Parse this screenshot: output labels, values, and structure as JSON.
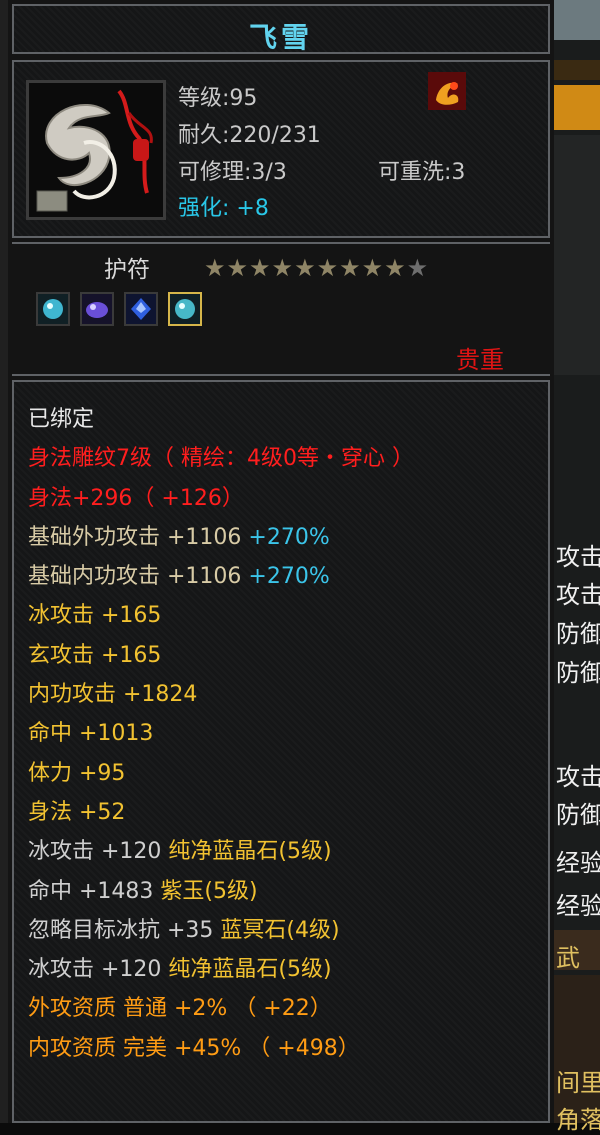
{
  "item": {
    "name": "飞雪",
    "level_text": "等级:95",
    "durability_text": "耐久:220/231",
    "repairable_text": "可修理:3/3",
    "rewash_text": "可重洗:3",
    "enhance_text": "强化: +8",
    "type": "护符",
    "stars_filled": 9,
    "stars_total": 10,
    "stars_text": "★★★★★★★★★",
    "stars_off_text": "★",
    "precious_text": "贵重",
    "gems": [
      {
        "icon": "teal-gem-icon",
        "color": "#3fb6d0"
      },
      {
        "icon": "purple-gem-icon",
        "color": "#6a4fd8"
      },
      {
        "icon": "blue-gem-icon",
        "color": "#2f5fe0"
      },
      {
        "icon": "teal-gem-icon",
        "color": "#47b8c8",
        "selected": true
      }
    ]
  },
  "stats": {
    "bound": "已绑定",
    "engrave": "身法雕纹7级（ 精绘：4级0等・穿心 ）",
    "agility_main": "身法+296（ +126）",
    "base_outer_label": "基础外功攻击 +1106 ",
    "base_outer_pct": "+270%",
    "base_inner_label": "基础内功攻击 +1106 ",
    "base_inner_pct": "+270%",
    "ice_attack": "冰攻击 +165",
    "xuan_attack": "玄攻击 +165",
    "inner_attack": "内功攻击 +1824",
    "hit": "命中 +1013",
    "stamina": "体力 +95",
    "agility": "身法 +52",
    "gem1_label": "冰攻击 +120 ",
    "gem1_name": "纯净蓝晶石(5级)",
    "gem2_label": "命中 +1483 ",
    "gem2_name": "紫玉(5级)",
    "gem3_label": "忽略目标冰抗 +35 ",
    "gem3_name": "蓝冥石(4级)",
    "gem4_label": "冰攻击 +120 ",
    "gem4_name": "纯净蓝晶石(5级)",
    "outer_quality": "外攻资质  普通 +2% （ +22）",
    "inner_quality": "内攻资质  完美 +45% （ +498）"
  },
  "background": {
    "right_texts": [
      "攻击",
      "攻击",
      "防御",
      "防御",
      "攻击",
      "防御",
      "经验",
      "经验",
      "武",
      "间里",
      "角落"
    ]
  }
}
